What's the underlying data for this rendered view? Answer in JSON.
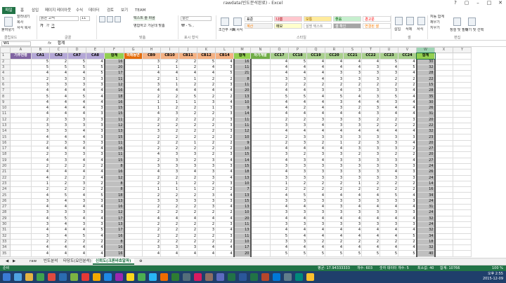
{
  "app": {
    "title": "rawdata(빈도분석완료) - Excel",
    "win": {
      "help": "?",
      "restore": "▢",
      "minimize": "–",
      "maximize": "□",
      "close": "✕"
    }
  },
  "tabs": [
    "파일",
    "홈",
    "삽입",
    "페이지 레이아웃",
    "수식",
    "데이터",
    "검토",
    "보기",
    "TEAM"
  ],
  "ribbon": {
    "clipboard": {
      "paste": "붙여넣기",
      "cut": "잘라내기",
      "copy": "복사",
      "format_painter": "서식 복사",
      "label": "클립보드"
    },
    "font": {
      "name": "맑은 고딕",
      "size": "11",
      "label": "글꼴"
    },
    "align": {
      "wrap": "텍스트 줄 바꿈",
      "merge": "병합하고 가운데 맞춤",
      "label": "맞춤"
    },
    "number": {
      "format": "일반",
      "label": "표시 형식"
    },
    "styles": {
      "conditional": "조건부 서식",
      "table": "표 서식",
      "label": "스타일",
      "cells": [
        {
          "text": "표준",
          "bg": "#ffffff",
          "fg": "#000000"
        },
        {
          "text": "나쁨",
          "bg": "#ffc7ce",
          "fg": "#9c0006"
        },
        {
          "text": "보통",
          "bg": "#ffeb9c",
          "fg": "#9c6500"
        },
        {
          "text": "좋음",
          "bg": "#c6efce",
          "fg": "#006100"
        },
        {
          "text": "경고문",
          "bg": "#ffffff",
          "fg": "#ff0000"
        },
        {
          "text": "계산",
          "bg": "#f2f2f2",
          "fg": "#fa7d00"
        },
        {
          "text": "메모",
          "bg": "#ffffcc",
          "fg": "#000000"
        },
        {
          "text": "설명 텍스트",
          "bg": "#ffffff",
          "fg": "#7f7f7f"
        },
        {
          "text": "셀 확인",
          "bg": "#a5a5a5",
          "fg": "#ffffff"
        },
        {
          "text": "연결된 셀",
          "bg": "#ffffff",
          "fg": "#fa7d00"
        }
      ]
    },
    "cells": {
      "insert": "삽입",
      "delete": "삭제",
      "format": "서식",
      "label": "셀"
    },
    "editing": {
      "autosum": "자동 합계",
      "fill": "채우기",
      "clear": "지우기",
      "sort": "정렬 및 필터",
      "find": "찾기 및 선택",
      "label": "편집"
    }
  },
  "formula": {
    "namebox": "W1",
    "fx": "fx",
    "value": "합계"
  },
  "columns": [
    "A",
    "B",
    "C",
    "D",
    "E",
    "F",
    "G",
    "H",
    "I",
    "J",
    "K",
    "L",
    "M",
    "N",
    "O",
    "P",
    "Q",
    "R",
    "S",
    "T",
    "U",
    "V",
    "W",
    "X",
    "Y"
  ],
  "headers": [
    {
      "text": "기주연령",
      "bg": "#8064a2",
      "fg": "#ffffff"
    },
    {
      "text": "CA1",
      "bg": "#b4a7d6",
      "fg": "#000000"
    },
    {
      "text": "CA2",
      "bg": "#b4a7d6",
      "fg": "#000000"
    },
    {
      "text": "CA7",
      "bg": "#b4a7d6",
      "fg": "#000000"
    },
    {
      "text": "CA8",
      "bg": "#b4a7d6",
      "fg": "#000000"
    },
    {
      "text": "합계",
      "bg": "#92d050",
      "fg": "#000000"
    },
    {
      "text": "미래등연",
      "bg": "#e46c0a",
      "fg": "#ffffff"
    },
    {
      "text": "CB9",
      "bg": "#f4b183",
      "fg": "#000000"
    },
    {
      "text": "CB10",
      "bg": "#f4b183",
      "fg": "#000000"
    },
    {
      "text": "CB11",
      "bg": "#f4b183",
      "fg": "#000000"
    },
    {
      "text": "CB12",
      "bg": "#f4b183",
      "fg": "#000000"
    },
    {
      "text": "CB14",
      "bg": "#f4b183",
      "fg": "#000000"
    },
    {
      "text": "합계",
      "bg": "#92d050",
      "fg": "#000000"
    },
    {
      "text": "자기계발",
      "bg": "#70ad47",
      "fg": "#ffffff"
    },
    {
      "text": "CC17",
      "bg": "#a9d08e",
      "fg": "#000000"
    },
    {
      "text": "CC18",
      "bg": "#a9d08e",
      "fg": "#000000"
    },
    {
      "text": "CC19",
      "bg": "#a9d08e",
      "fg": "#000000"
    },
    {
      "text": "CC20",
      "bg": "#a9d08e",
      "fg": "#000000"
    },
    {
      "text": "CC21",
      "bg": "#a9d08e",
      "fg": "#000000"
    },
    {
      "text": "CC22",
      "bg": "#a9d08e",
      "fg": "#000000"
    },
    {
      "text": "CC23",
      "bg": "#a9d08e",
      "fg": "#000000"
    },
    {
      "text": "CC24",
      "bg": "#a9d08e",
      "fg": "#000000"
    },
    {
      "text": "합계",
      "bg": "#92d050",
      "fg": "#000000"
    }
  ],
  "rows": [
    [
      5,
      2,
      5,
      4,
      16,
      3,
      2,
      2,
      5,
      4,
      16,
      4,
      5,
      4,
      4,
      4,
      4,
      5,
      4,
      30
    ],
    [
      5,
      5,
      5,
      5,
      20,
      1,
      1,
      2,
      4,
      3,
      11,
      4,
      4,
      4,
      4,
      4,
      3,
      4,
      5,
      32
    ],
    [
      4,
      4,
      4,
      5,
      17,
      4,
      4,
      4,
      4,
      5,
      21,
      4,
      4,
      4,
      3,
      3,
      3,
      3,
      4,
      28
    ],
    [
      2,
      3,
      3,
      3,
      11,
      2,
      1,
      1,
      2,
      2,
      8,
      3,
      3,
      4,
      3,
      3,
      3,
      2,
      2,
      22
    ],
    [
      3,
      3,
      3,
      3,
      12,
      3,
      1,
      2,
      2,
      3,
      11,
      2,
      2,
      2,
      2,
      2,
      2,
      2,
      2,
      15
    ],
    [
      4,
      4,
      4,
      4,
      16,
      4,
      4,
      4,
      4,
      4,
      20,
      4,
      4,
      3,
      4,
      3,
      3,
      3,
      4,
      28
    ],
    [
      5,
      4,
      5,
      4,
      18,
      2,
      2,
      5,
      2,
      2,
      13,
      5,
      5,
      4,
      5,
      4,
      3,
      5,
      4,
      35
    ],
    [
      4,
      4,
      4,
      4,
      16,
      1,
      1,
      1,
      3,
      4,
      10,
      4,
      4,
      4,
      3,
      4,
      4,
      3,
      4,
      30
    ],
    [
      4,
      4,
      4,
      3,
      15,
      1,
      2,
      2,
      1,
      3,
      9,
      4,
      2,
      4,
      3,
      2,
      3,
      4,
      4,
      26
    ],
    [
      4,
      4,
      4,
      3,
      15,
      4,
      3,
      2,
      2,
      3,
      14,
      4,
      4,
      4,
      4,
      4,
      3,
      4,
      4,
      31
    ],
    [
      2,
      3,
      3,
      3,
      11,
      2,
      2,
      2,
      2,
      3,
      11,
      2,
      2,
      3,
      3,
      3,
      2,
      2,
      3,
      20
    ],
    [
      3,
      3,
      3,
      3,
      12,
      2,
      2,
      2,
      2,
      3,
      11,
      3,
      3,
      4,
      3,
      3,
      2,
      2,
      2,
      22
    ],
    [
      3,
      3,
      4,
      3,
      13,
      3,
      2,
      2,
      2,
      3,
      12,
      4,
      4,
      4,
      4,
      4,
      4,
      4,
      4,
      32
    ],
    [
      4,
      4,
      4,
      3,
      15,
      2,
      2,
      2,
      2,
      2,
      10,
      2,
      3,
      3,
      3,
      3,
      3,
      3,
      3,
      23
    ],
    [
      2,
      3,
      3,
      3,
      11,
      2,
      2,
      1,
      2,
      2,
      9,
      2,
      3,
      2,
      1,
      2,
      3,
      3,
      4,
      20
    ],
    [
      4,
      4,
      4,
      4,
      16,
      2,
      2,
      2,
      2,
      2,
      10,
      4,
      4,
      4,
      4,
      3,
      3,
      3,
      2,
      27
    ],
    [
      2,
      3,
      3,
      3,
      11,
      4,
      3,
      3,
      2,
      3,
      15,
      3,
      2,
      3,
      3,
      2,
      3,
      2,
      2,
      20
    ],
    [
      4,
      3,
      4,
      4,
      15,
      2,
      3,
      2,
      3,
      4,
      14,
      4,
      3,
      4,
      3,
      3,
      3,
      3,
      4,
      27
    ],
    [
      2,
      2,
      2,
      2,
      8,
      3,
      3,
      3,
      3,
      3,
      15,
      3,
      3,
      3,
      3,
      3,
      3,
      3,
      3,
      24
    ],
    [
      4,
      4,
      4,
      4,
      16,
      4,
      3,
      4,
      3,
      4,
      18,
      4,
      3,
      3,
      3,
      3,
      3,
      4,
      3,
      26
    ],
    [
      4,
      2,
      2,
      4,
      12,
      2,
      2,
      2,
      3,
      4,
      13,
      3,
      3,
      3,
      3,
      3,
      3,
      3,
      3,
      24
    ],
    [
      1,
      2,
      3,
      2,
      8,
      2,
      1,
      2,
      2,
      3,
      10,
      1,
      2,
      2,
      2,
      1,
      2,
      2,
      2,
      14
    ],
    [
      2,
      2,
      2,
      2,
      8,
      1,
      1,
      1,
      2,
      2,
      7,
      2,
      2,
      2,
      2,
      2,
      2,
      2,
      2,
      16
    ],
    [
      4,
      5,
      4,
      5,
      18,
      2,
      2,
      2,
      3,
      4,
      13,
      4,
      5,
      4,
      4,
      4,
      4,
      5,
      4,
      34
    ],
    [
      3,
      4,
      3,
      3,
      13,
      3,
      3,
      3,
      3,
      3,
      15,
      3,
      3,
      3,
      3,
      3,
      3,
      3,
      3,
      24
    ],
    [
      4,
      4,
      4,
      4,
      16,
      2,
      2,
      2,
      3,
      4,
      13,
      4,
      4,
      4,
      3,
      4,
      4,
      4,
      4,
      31
    ],
    [
      3,
      3,
      3,
      3,
      12,
      2,
      2,
      2,
      2,
      2,
      10,
      3,
      3,
      3,
      3,
      3,
      3,
      3,
      3,
      24
    ],
    [
      4,
      5,
      4,
      4,
      17,
      4,
      4,
      4,
      4,
      4,
      20,
      4,
      4,
      4,
      4,
      4,
      4,
      4,
      4,
      32
    ],
    [
      3,
      4,
      3,
      3,
      13,
      2,
      2,
      2,
      2,
      3,
      11,
      3,
      3,
      3,
      3,
      3,
      3,
      3,
      3,
      24
    ],
    [
      4,
      4,
      4,
      5,
      17,
      2,
      2,
      2,
      3,
      4,
      13,
      4,
      4,
      4,
      4,
      4,
      4,
      4,
      4,
      32
    ],
    [
      3,
      4,
      5,
      4,
      16,
      2,
      2,
      2,
      2,
      3,
      11,
      5,
      4,
      4,
      4,
      4,
      4,
      4,
      5,
      34
    ],
    [
      2,
      2,
      2,
      2,
      8,
      2,
      2,
      2,
      2,
      2,
      10,
      3,
      3,
      2,
      2,
      2,
      2,
      2,
      2,
      18
    ],
    [
      4,
      4,
      4,
      4,
      16,
      3,
      3,
      3,
      4,
      4,
      17,
      4,
      4,
      4,
      4,
      4,
      4,
      4,
      4,
      32
    ],
    [
      4,
      4,
      4,
      4,
      16,
      4,
      4,
      4,
      4,
      4,
      20,
      5,
      5,
      5,
      5,
      5,
      5,
      5,
      5,
      40
    ]
  ],
  "sheet_tabs": [
    "raw",
    "빈도분석",
    "타당도(요인분석)",
    "신뢰도(크론바흐알파)"
  ],
  "status": {
    "mode": "준비",
    "avg": "평균: 17.94333333",
    "count": "개수: 603",
    "num_count": "숫자 데이터 개수: 5",
    "min": "최소값: 40",
    "sum": "합계: 10766",
    "zoom": "100 %"
  },
  "clock": {
    "time": "오후 2:55",
    "date": "2015-12-09"
  }
}
